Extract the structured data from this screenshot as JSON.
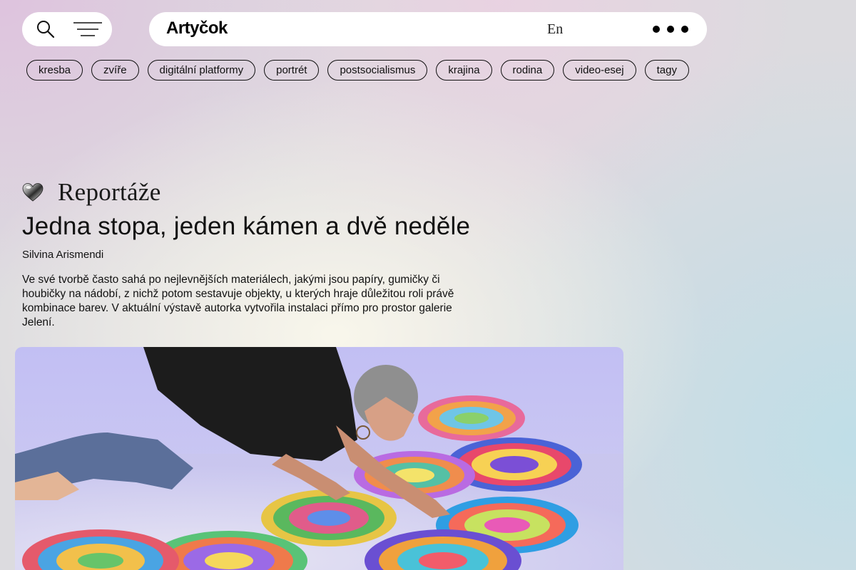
{
  "header": {
    "logo": "Artyčok",
    "language": "En",
    "icons": {
      "search": "search-icon",
      "menu": "hamburger-menu-icon",
      "more": "more-dots-icon"
    }
  },
  "tags": [
    "kresba",
    "zvíře",
    "digitální platformy",
    "portrét",
    "postsocialismus",
    "krajina",
    "rodina",
    "video-esej",
    "tagy"
  ],
  "article": {
    "category": "Reportáže",
    "category_icon": "chrome-heart-icon",
    "title": "Jedna stopa, jeden kámen a dvě neděle",
    "author": "Silvina Arismendi",
    "perex": "Ve své tvorbě často sahá po nejlevnějších materiálech, jakými jsou papíry, gumičky či houbičky na nádobí, z nichž potom sestavuje objekty, u kterých hraje důležitou roli právě kombinace barev. V aktuální výstavě autorka vytvořila instalaci přímo pro prostor galerie Jelení."
  },
  "colors": {
    "accent_background": "#ffffff",
    "text": "#111111",
    "photo_backdrop": "#c3c0f2"
  }
}
